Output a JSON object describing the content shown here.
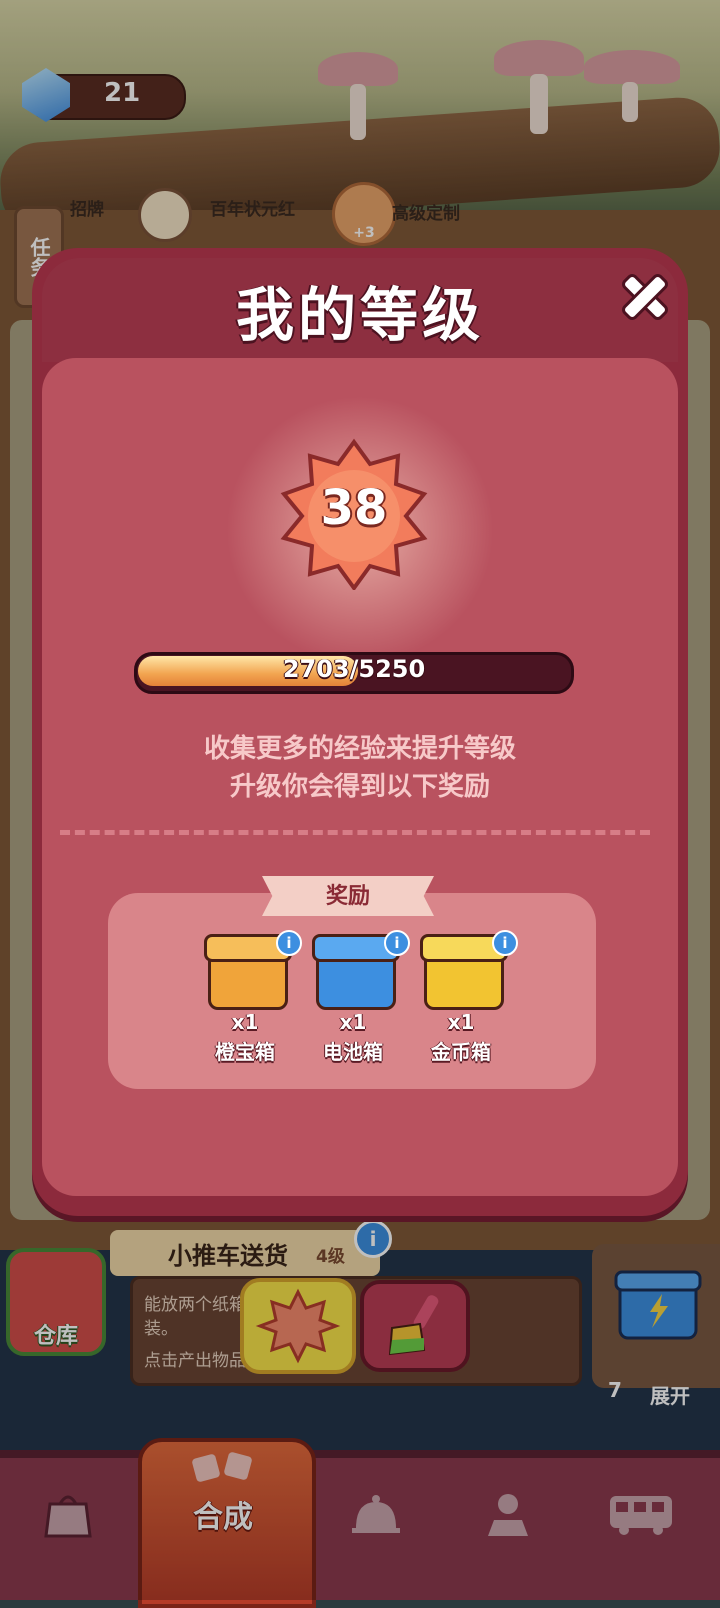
{
  "top_bar": {
    "gem_count": "21",
    "gem_icon": "diamond-icon"
  },
  "task_button": {
    "label": "任务"
  },
  "task_strip": {
    "items": [
      "招牌",
      "百年状元红",
      "高级定制"
    ],
    "fish_badge": "+3"
  },
  "level_dialog": {
    "title": "我的等级",
    "level": "38",
    "progress_text": "2703/5250",
    "progress_fraction": 0.515,
    "description_line1": "收集更多的经验来提升等级",
    "description_line2": "升级你会得到以下奖励",
    "rewards_title": "奖励",
    "rewards": [
      {
        "qty": "x1",
        "name": "橙宝箱",
        "color": "#f0a43a",
        "icon": "orange-chest-icon"
      },
      {
        "qty": "x1",
        "name": "电池箱",
        "color": "#3d8fe0",
        "icon": "battery-box-icon"
      },
      {
        "qty": "x1",
        "name": "金币箱",
        "color": "#f2c431",
        "icon": "coin-box-icon"
      }
    ],
    "info_glyph": "i"
  },
  "bottom_panel": {
    "store_label": "仓库",
    "cart_title": "小推车送货",
    "cart_level": "4级",
    "cart_desc_line1": "能放两个纸箱",
    "cart_desc_line2": "装。",
    "cart_desc_line3": "点击产出物品",
    "cart_info": "i",
    "right_count": "7",
    "right_expand": "展开"
  },
  "nav": {
    "active_label": "合成",
    "icons": [
      "bag-icon",
      "merge-icon",
      "service-bell-icon",
      "map-person-icon",
      "bus-icon"
    ]
  }
}
